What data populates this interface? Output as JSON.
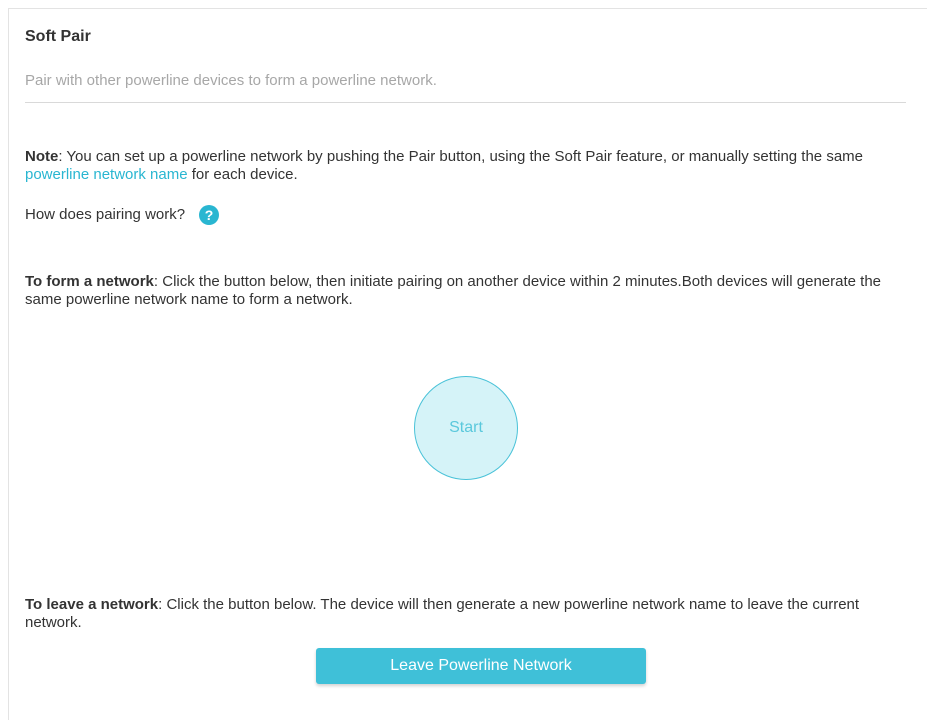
{
  "header": {
    "title": "Soft Pair",
    "subtitle": "Pair with other powerline devices to form a powerline network."
  },
  "note": {
    "label": "Note",
    "text_before": ": You can set up a powerline network by pushing the Pair button, using the Soft Pair feature, or manually setting the same ",
    "link_text": "powerline network name",
    "text_after": " for each device."
  },
  "how": {
    "question": "How does pairing work?",
    "help_icon": "question-circle-icon",
    "help_glyph": "?"
  },
  "form": {
    "label": "To form a network",
    "text": ": Click the button below, then initiate pairing on another device within 2 minutes.Both devices will generate the same powerline network name to form a network.",
    "start_label": "Start"
  },
  "leave": {
    "label": "To leave a network",
    "text": ": Click the button below. The device will then generate a new powerline network name to leave the current network.",
    "button_label": "Leave Powerline Network"
  },
  "colors": {
    "accent": "#29b6d1",
    "button": "#3fc0d8",
    "start_fill": "#d5f3f8"
  }
}
